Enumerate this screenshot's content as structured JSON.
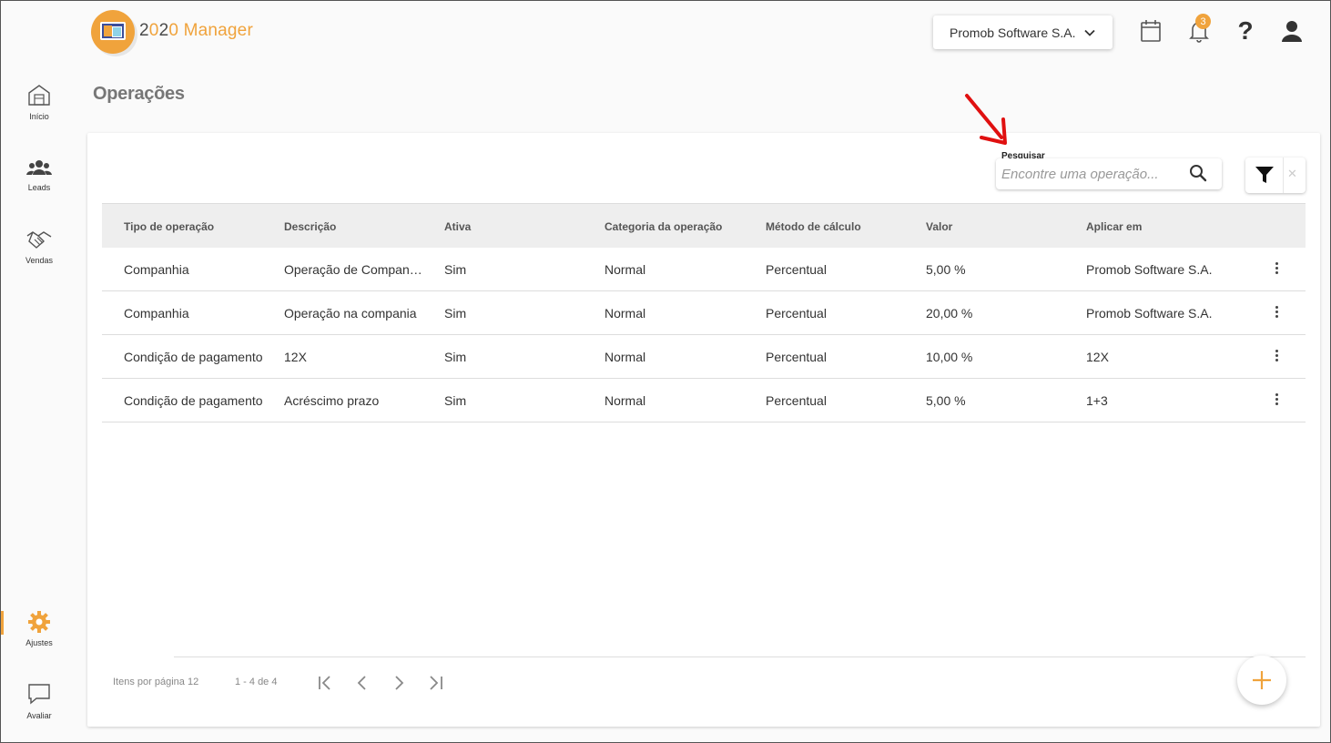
{
  "header": {
    "logo_prefix": "2",
    "logo_middle": "0",
    "logo_suffix": "20 Manager",
    "company": "Promob Software S.A.",
    "notifications_count": "3",
    "help_glyph": "?"
  },
  "sidebar": {
    "items": [
      {
        "label": "Início",
        "icon": "home-icon"
      },
      {
        "label": "Leads",
        "icon": "people-icon"
      },
      {
        "label": "Vendas",
        "icon": "handshake-icon"
      },
      {
        "label": "Ajustes",
        "icon": "gear-icon",
        "active": true
      },
      {
        "label": "Avaliar",
        "icon": "chat-icon"
      }
    ]
  },
  "page": {
    "title": "Operações",
    "search_label": "Pesquisar",
    "search_placeholder": "Encontre uma operação...",
    "search_value": ""
  },
  "table": {
    "headers": [
      "Tipo de operação",
      "Descrição",
      "Ativa",
      "Categoria da operação",
      "Método de cálculo",
      "Valor",
      "Aplicar em"
    ],
    "rows": [
      [
        "Companhia",
        "Operação de Companh...",
        "Sim",
        "Normal",
        "Percentual",
        "5,00 %",
        "Promob Software S.A."
      ],
      [
        "Companhia",
        "Operação na compania",
        "Sim",
        "Normal",
        "Percentual",
        "20,00 %",
        "Promob Software S.A."
      ],
      [
        "Condição de pagamento",
        "12X",
        "Sim",
        "Normal",
        "Percentual",
        "10,00 %",
        "12X"
      ],
      [
        "Condição de pagamento",
        "Acréscimo prazo",
        "Sim",
        "Normal",
        "Percentual",
        "5,00 %",
        "1+3"
      ]
    ]
  },
  "pagination": {
    "items_per_page": "Itens por página 12",
    "range": "1 - 4 de 4"
  },
  "colors": {
    "accent": "#f0a33c",
    "annotation_arrow": "#e01010"
  }
}
